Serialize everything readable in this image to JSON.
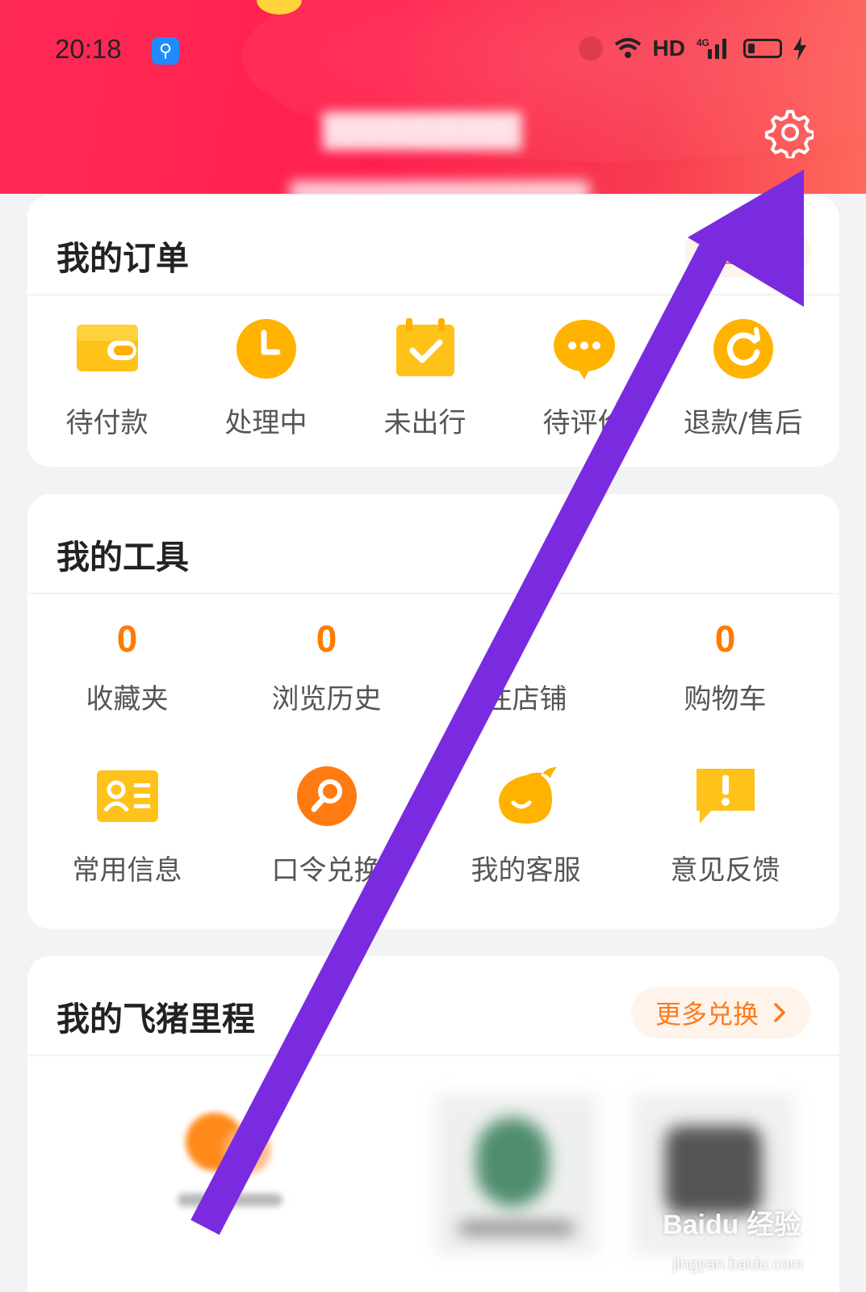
{
  "status_bar": {
    "time": "20:18",
    "right_text": "HD",
    "network": "4G"
  },
  "header": {
    "settings_icon": "gear-icon",
    "accent_color": "#ff2a55"
  },
  "orders": {
    "title": "我的订单",
    "all_button": "全部订",
    "items": [
      {
        "label": "待付款",
        "icon": "wallet-icon"
      },
      {
        "label": "处理中",
        "icon": "clock-icon"
      },
      {
        "label": "未出行",
        "icon": "calendar-check-icon"
      },
      {
        "label": "待评价",
        "icon": "chat-bubble-icon"
      },
      {
        "label": "退款/售后",
        "icon": "refresh-icon"
      }
    ]
  },
  "tools": {
    "title": "我的工具",
    "counts": [
      {
        "value": "0",
        "label": "收藏夹"
      },
      {
        "value": "0",
        "label": "浏览历史"
      },
      {
        "value": "",
        "label": "注店铺"
      },
      {
        "value": "0",
        "label": "购物车"
      }
    ],
    "items": [
      {
        "label": "常用信息",
        "icon": "contact-card-icon"
      },
      {
        "label": "口令兑换",
        "icon": "search-key-icon"
      },
      {
        "label": "我的客服",
        "icon": "service-mascot-icon"
      },
      {
        "label": "意见反馈",
        "icon": "feedback-icon"
      }
    ]
  },
  "mileage": {
    "title": "我的飞猪里程",
    "more_button": "更多兑换"
  },
  "watermark": {
    "brand": "Baidu 经验",
    "url": "jingyan.baidu.com"
  },
  "colors": {
    "orange": "#ff7a00",
    "arrow": "#7a2be0"
  }
}
